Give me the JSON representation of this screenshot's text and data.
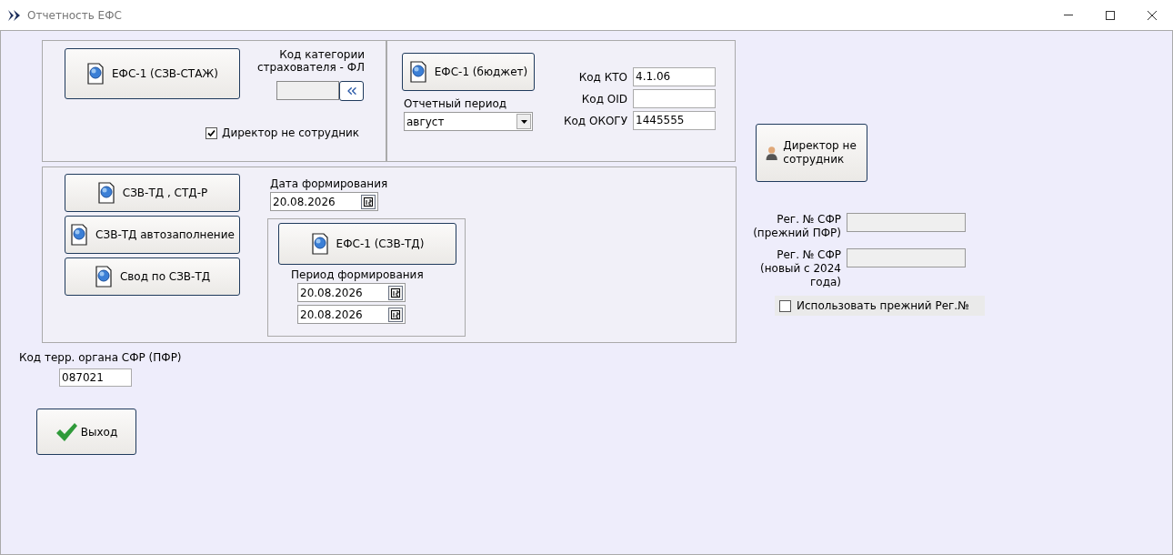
{
  "window": {
    "title": "Отчетность ЕФС"
  },
  "efs_staj": {
    "button": "ЕФС-1 (СЗВ-СТАЖ)",
    "category_label": "Код категории страхователя - ФЛ",
    "director_checkbox": {
      "label": "Директор не сотрудник",
      "checked": true
    }
  },
  "budget": {
    "button": "ЕФС-1 (бюджет)",
    "period_label": "Отчетный период",
    "period_value": "август",
    "codes": [
      {
        "label": "Код КТО",
        "value": "4.1.06"
      },
      {
        "label": "Код OID"
      },
      {
        "label": "Код ОКОГУ",
        "value": "1445555"
      }
    ]
  },
  "szv_td": {
    "buttons": [
      "СЗВ-ТД , СТД-Р",
      "СЗВ-ТД автозаполнение",
      "Свод по СЗВ-ТД"
    ],
    "date_label": "Дата формирования",
    "date": "20.08.2026",
    "efs_button": "ЕФС-1 (СЗВ-ТД)",
    "period_label": "Период формирования",
    "period_from": "20.08.2026",
    "period_to": "20.08.2026"
  },
  "right": {
    "director_button": "Директор не сотрудник",
    "reg_fields": [
      {
        "label_lines": [
          "Рег. № СФР",
          "(прежний ПФР)"
        ]
      },
      {
        "label_lines": [
          "Рег. № СФР",
          "(новый с 2024 года)"
        ]
      }
    ],
    "use_old_checkbox": {
      "label": "Использовать прежний Рег.№",
      "checked": false
    }
  },
  "terr_code": {
    "label": "Код терр. органа СФР (ПФР)",
    "value": "087021"
  },
  "exit_button": "Выход"
}
